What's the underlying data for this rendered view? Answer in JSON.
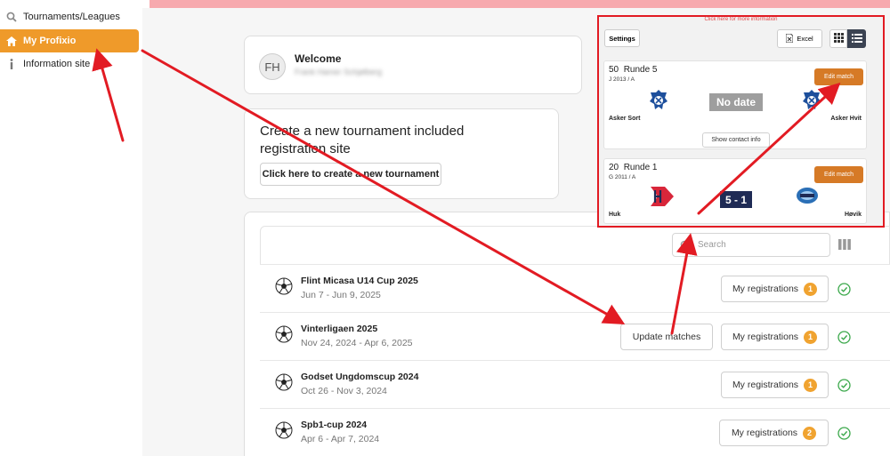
{
  "sidebar": {
    "items": [
      {
        "label": "Tournaments/Leagues",
        "icon": "search-icon"
      },
      {
        "label": "My Profixio",
        "icon": "home-icon"
      },
      {
        "label": "Information site",
        "icon": "info-icon"
      }
    ]
  },
  "welcome": {
    "initials": "FH",
    "title": "Welcome",
    "subtitle": "Frank Hamer Schjølberg"
  },
  "create": {
    "title": "Create a new tournament included registration site",
    "button": "Click here to create a new tournament"
  },
  "list": {
    "search_placeholder": "Search",
    "rows": [
      {
        "title": "Flint Micasa U14 Cup 2025",
        "dates": "Jun 7 - Jun 9, 2025",
        "reg_label": "My registrations",
        "reg_count": "1",
        "update_label": ""
      },
      {
        "title": "Vinterligaen 2025",
        "dates": "Nov 24, 2024 - Apr 6, 2025",
        "reg_label": "My registrations",
        "reg_count": "1",
        "update_label": "Update matches"
      },
      {
        "title": "Godset Ungdomscup 2024",
        "dates": "Oct 26 - Nov 3, 2024",
        "reg_label": "My registrations",
        "reg_count": "1",
        "update_label": ""
      },
      {
        "title": "Spb1-cup 2024",
        "dates": "Apr 6 - Apr 7, 2024",
        "reg_label": "My registrations",
        "reg_count": "2",
        "update_label": ""
      }
    ]
  },
  "overlay": {
    "hint": "Click here for more information",
    "settings": "Settings",
    "excel": "Excel",
    "matches": [
      {
        "number": "50",
        "round": "Runde 5",
        "group": "J 2013 / A",
        "edit": "Edit match",
        "home": "Asker Sort",
        "away": "Asker Hvit",
        "result": "No date",
        "contact": "Show contact info"
      },
      {
        "number": "20",
        "round": "Runde 1",
        "group": "G 2011 / A",
        "edit": "Edit match",
        "home": "Huk",
        "away": "Høvik",
        "result": "5 - 1"
      }
    ]
  },
  "colors": {
    "accent": "#ef9a2a",
    "edit_button": "#d67a26",
    "highlight_border": "#e21b23",
    "score_bg": "#1f2b55",
    "check_green": "#3aa84a"
  }
}
